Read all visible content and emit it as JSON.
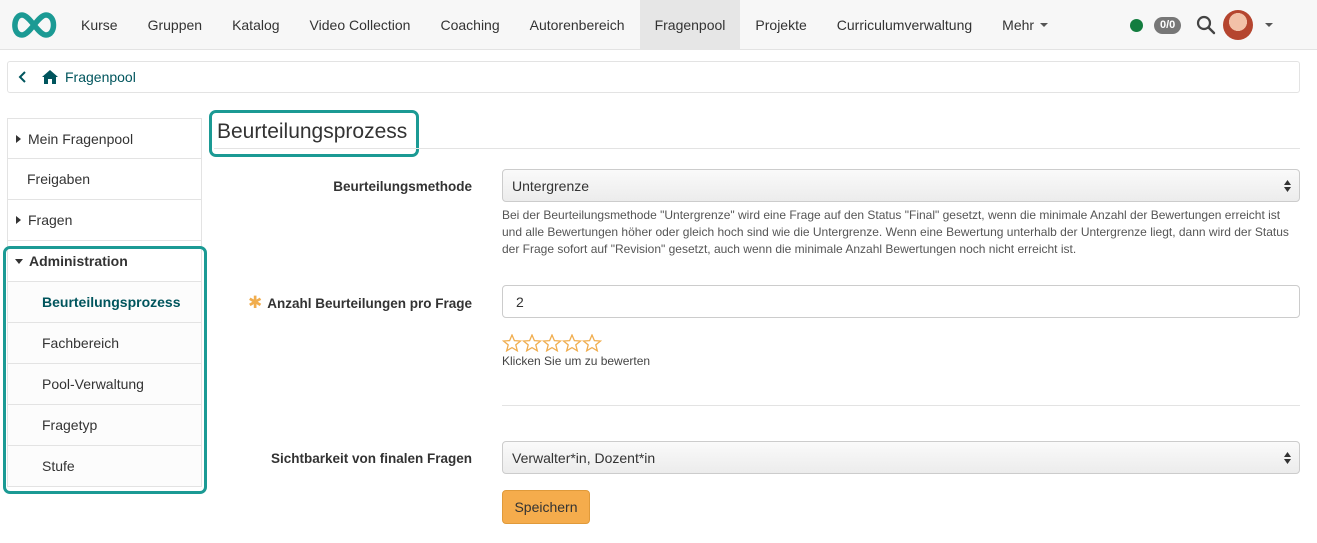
{
  "nav": {
    "items": [
      {
        "label": "Kurse"
      },
      {
        "label": "Gruppen"
      },
      {
        "label": "Katalog"
      },
      {
        "label": "Video Collection"
      },
      {
        "label": "Coaching"
      },
      {
        "label": "Autorenbereich"
      },
      {
        "label": "Fragenpool",
        "active": true
      },
      {
        "label": "Projekte"
      },
      {
        "label": "Curriculumverwaltung"
      },
      {
        "label": "Mehr",
        "dropdown": true
      }
    ],
    "badge": "0/0",
    "status_color": "#137d3f",
    "logo_color": "#1b9a94"
  },
  "breadcrumb": {
    "label": "Fragenpool"
  },
  "sidebar": {
    "items": [
      {
        "label": "Mein Fragenpool",
        "expandable": true
      },
      {
        "label": "Freigaben"
      },
      {
        "label": "Fragen",
        "expandable": true
      },
      {
        "label": "Administration",
        "expanded": true
      },
      {
        "label": "Beurteilungsprozess",
        "current": true
      },
      {
        "label": "Fachbereich"
      },
      {
        "label": "Pool-Verwaltung"
      },
      {
        "label": "Fragetyp"
      },
      {
        "label": "Stufe"
      }
    ]
  },
  "main": {
    "title": "Beurteilungsprozess",
    "method": {
      "label": "Beurteilungsmethode",
      "value": "Untergrenze",
      "help": "Bei der Beurteilungsmethode \"Untergrenze\" wird eine Frage auf den Status \"Final\" gesetzt, wenn die minimale Anzahl der Bewertungen erreicht ist und alle Bewertungen höher oder gleich hoch sind wie die Untergrenze. Wenn eine Bewertung unterhalb der Untergrenze liegt, dann wird der Status der Frage sofort auf \"Revision\" gesetzt, auch wenn die minimale Anzahl Bewertungen noch nicht erreicht ist."
    },
    "count": {
      "required_mark": "✱",
      "label": "Anzahl Beurteilungen pro Frage",
      "value": "2"
    },
    "rating": {
      "stars_total": 5,
      "stars_filled": 0,
      "hint": "Klicken Sie um zu bewerten",
      "color": "#f0ad4e"
    },
    "visibility": {
      "label": "Sichtbarkeit von finalen Fragen",
      "value": "Verwalter*in, Dozent*in"
    },
    "save_label": "Speichern"
  },
  "highlight_color": "#1b9a94"
}
